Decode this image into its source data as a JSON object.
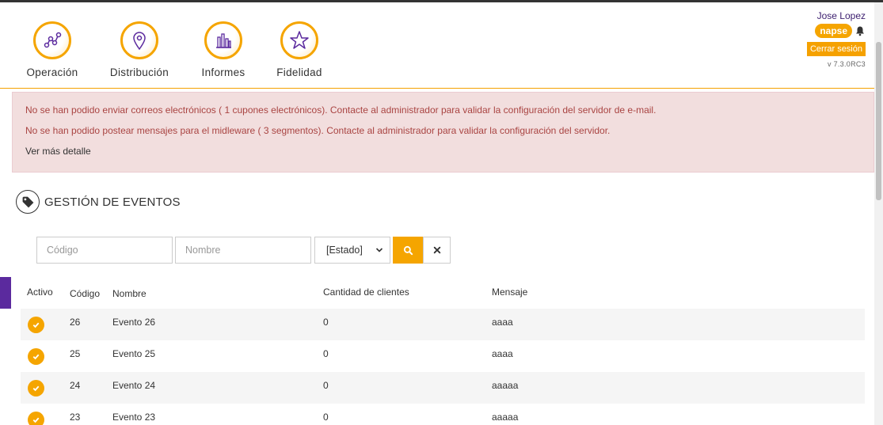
{
  "nav": [
    {
      "label": "Operación",
      "icon": "operation-icon"
    },
    {
      "label": "Distribución",
      "icon": "location-pin-icon"
    },
    {
      "label": "Informes",
      "icon": "bar-chart-icon"
    },
    {
      "label": "Fidelidad",
      "icon": "star-icon"
    }
  ],
  "user": {
    "name": "Jose Lopez",
    "brand": "napse",
    "logout_label": "Cerrar sesión",
    "version": "v 7.3.0RC3"
  },
  "alerts": {
    "messages": [
      "No se han podido enviar correos electrónicos ( 1 cupones electrónicos). Contacte al administrador para validar la configuración del servidor de e-mail.",
      "No se han podido postear mensajes para el midleware ( 3 segmentos). Contacte al administrador para validar la configuración del servidor."
    ],
    "more_label": "Ver más detalle"
  },
  "section": {
    "title": "GESTIÓN DE EVENTOS"
  },
  "filters": {
    "code_placeholder": "Código",
    "name_placeholder": "Nombre",
    "state_value": "[Estado]"
  },
  "table": {
    "headers": [
      "Activo",
      "Código",
      "Nombre",
      "Cantidad de clientes",
      "Mensaje"
    ],
    "rows": [
      {
        "active": true,
        "code": "26",
        "name": "Evento 26",
        "clients": "0",
        "message": "aaaa"
      },
      {
        "active": true,
        "code": "25",
        "name": "Evento 25",
        "clients": "0",
        "message": "aaaa"
      },
      {
        "active": true,
        "code": "24",
        "name": "Evento 24",
        "clients": "0",
        "message": "aaaaa"
      },
      {
        "active": true,
        "code": "23",
        "name": "Evento 23",
        "clients": "0",
        "message": "aaaaa"
      }
    ]
  },
  "colors": {
    "accent": "#f5a500",
    "alert_bg": "#f2dede",
    "alert_text": "#a94442",
    "brand_purple": "#5b2a9e"
  }
}
